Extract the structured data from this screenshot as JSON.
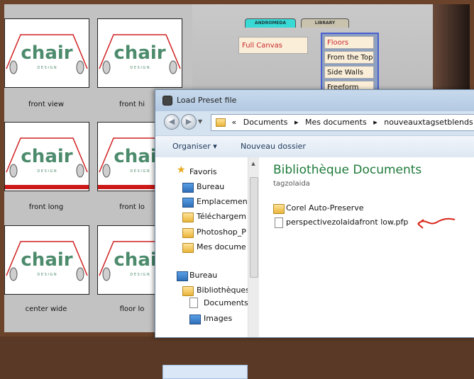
{
  "background_app": {
    "thumbnails": [
      {
        "label": "front view"
      },
      {
        "label": "front hi"
      },
      {
        "label": "front long"
      },
      {
        "label": "front lo"
      },
      {
        "label": "center wide"
      },
      {
        "label": "floor lo"
      }
    ],
    "thumb_text": {
      "word": "chair",
      "sub": "D E S I G N"
    },
    "tabs": {
      "andromeda": "ANDROMEDA",
      "library": "LIBRARY"
    },
    "canvas_item": "Full Canvas",
    "menu_items": [
      "Floors",
      "From the Top",
      "Side Walls",
      "Freeform"
    ]
  },
  "dialog": {
    "title": "Load Preset file",
    "nav_back": "◀",
    "nav_forward": "▶",
    "address": {
      "prefix": "«",
      "segments": [
        "Documents",
        "Mes documents",
        "nouveauxtagsetblends"
      ]
    },
    "toolbar": {
      "organiser": "Organiser ▾",
      "nouveau_dossier": "Nouveau dossier"
    },
    "nav_pane": {
      "favoris": "Favoris",
      "items": [
        "Bureau",
        "Emplacement",
        "Téléchargem",
        "Photoshop_P",
        "Mes docume"
      ],
      "bureau": "Bureau",
      "bibliotheques": "Bibliothèques",
      "documents": "Documents",
      "images": "Images"
    },
    "content": {
      "title": "Bibliothèque Documents",
      "subtitle": "tagzolaida",
      "files": [
        {
          "name": "Corel Auto-Preserve",
          "kind": "folder"
        },
        {
          "name": "perspectivezolaidafront low.pfp",
          "kind": "file"
        }
      ]
    }
  },
  "colors": {
    "accent_green": "#1e7a3a",
    "annotation_red": "#d9241a"
  }
}
